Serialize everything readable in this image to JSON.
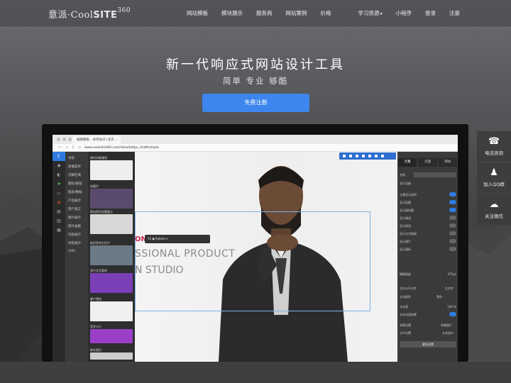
{
  "brand": {
    "cn": "意派",
    "sep": "·",
    "cool": "Cool",
    "site": "SITE",
    "suffix": "360"
  },
  "nav": {
    "items": [
      "网站模板",
      "模块展示",
      "服务商",
      "网站案例",
      "价格",
      "学习资源",
      "小程序",
      "登录",
      "注册"
    ]
  },
  "hero": {
    "title": "新一代响应式网站设计工具",
    "subtitle": "简单 专业 够酷",
    "cta": "免费注册"
  },
  "side": [
    {
      "icon": "phone-icon",
      "glyph": "☎",
      "label": "电话咨询"
    },
    {
      "icon": "qq-icon",
      "glyph": "♟",
      "label": "加入QQ群"
    },
    {
      "icon": "wechat-icon",
      "glyph": "☁",
      "label": "关注微信"
    }
  ],
  "editor": {
    "tab_title": "编辑模板 - 卓然站点 (北京...",
    "url": "www.coolsite360.com/sites/tofipu_draft/simple",
    "nav_glyphs": "← → C ⌂",
    "left_menu": [
      "导航",
      "轮播菜单",
      "页脚区域",
      "图标/按钮",
      "图表/数据",
      "产品展示",
      "用户留言",
      "图片展示",
      "图片画廊",
      "列表展示",
      "导航展示",
      "CMS"
    ],
    "left_icons": [
      "◉",
      "◐",
      "✚",
      "▭",
      "▤",
      "◍",
      "▥",
      "▦"
    ],
    "thumbs": [
      "简约风格通用",
      "标题栏",
      "网站首页标题展示",
      "图文展示",
      "网页宣传幻灯片",
      "多行文字表单",
      "客户预览",
      "竞争卡片",
      "联系我们"
    ],
    "canvas": {
      "accent": "ON",
      "line1": "SSIONAL PRODUCT",
      "line2": "N STUDIO",
      "font_tool": "50  ◼  Roboto  ▾"
    },
    "right_panel": {
      "tabs": [
        "元素",
        "页面",
        "网站"
      ],
      "name_label": "名称",
      "device_label": "显示设备",
      "rows": [
        {
          "label": "元素显示选项",
          "on": true
        },
        {
          "label": "显示标题",
          "on": true
        },
        {
          "label": "显示副标题",
          "on": true
        },
        {
          "label": "显示描述",
          "on": false
        },
        {
          "label": "显示按钮",
          "on": false
        },
        {
          "label": "显示文字链接",
          "on": false
        },
        {
          "label": "显示图片",
          "on": false
        },
        {
          "label": "显示图标",
          "on": false
        }
      ],
      "fields": [
        {
          "label": "横幅高度",
          "value": "475px"
        },
        {
          "label": "文本水平对齐",
          "value": "左对齐"
        },
        {
          "label": "文本颜色",
          "value": "黑色"
        },
        {
          "label": "文本宽",
          "value": "100 %"
        },
        {
          "label": "文本动画效果",
          "value": ""
        },
        {
          "label": "背景设置",
          "value": "背景图片"
        },
        {
          "label": "水平位置",
          "value": "文本居中"
        }
      ],
      "more_button": "更多设置"
    }
  },
  "colors": {
    "accent": "#3d86ee",
    "panel": "#3a3a3a",
    "toggle": "#2e7be0",
    "red": "#c8264e"
  }
}
